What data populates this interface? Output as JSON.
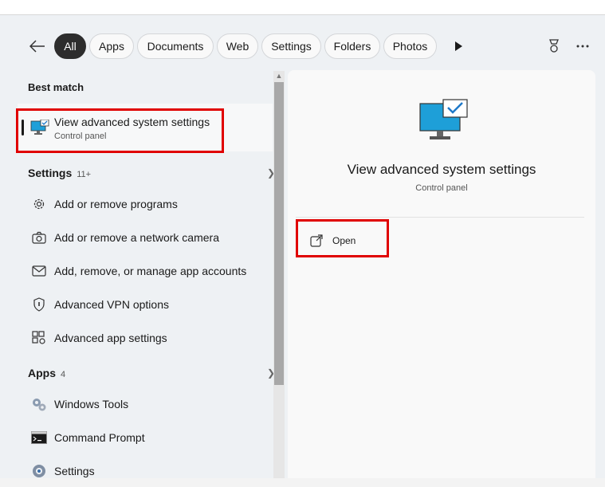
{
  "filters": {
    "back": "back-arrow",
    "tabs": [
      "All",
      "Apps",
      "Documents",
      "Web",
      "Settings",
      "Folders",
      "Photos"
    ],
    "active": "All"
  },
  "best_match": {
    "heading": "Best match",
    "title": "View advanced system settings",
    "subtitle": "Control panel"
  },
  "settings_section": {
    "heading": "Settings",
    "count": "11+",
    "items": [
      {
        "label": "Add or remove programs",
        "icon": "gear-icon"
      },
      {
        "label": "Add or remove a network camera",
        "icon": "camera-icon"
      },
      {
        "label": "Add, remove, or manage app accounts",
        "icon": "mail-icon"
      },
      {
        "label": "Advanced VPN options",
        "icon": "shield-icon"
      },
      {
        "label": "Advanced app settings",
        "icon": "app-settings-icon"
      }
    ]
  },
  "apps_section": {
    "heading": "Apps",
    "count": "4",
    "items": [
      {
        "label": "Windows Tools",
        "icon": "windows-tools-icon"
      },
      {
        "label": "Command Prompt",
        "icon": "command-prompt-icon"
      },
      {
        "label": "Settings",
        "icon": "settings-app-icon"
      }
    ]
  },
  "detail": {
    "title": "View advanced system settings",
    "subtitle": "Control panel",
    "actions": [
      {
        "label": "Open",
        "icon": "open-external-icon"
      }
    ]
  },
  "colors": {
    "highlight": "#e00000",
    "active_pill": "#2d2d2d",
    "monitor": "#1e9fd8"
  }
}
